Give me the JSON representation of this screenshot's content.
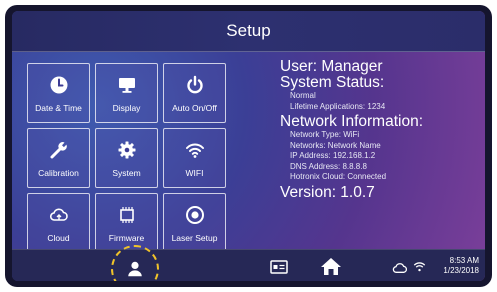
{
  "header": {
    "title": "Setup"
  },
  "tiles": [
    {
      "label": "Date & Time",
      "icon": "clock-icon"
    },
    {
      "label": "Display",
      "icon": "monitor-icon"
    },
    {
      "label": "Auto On/Off",
      "icon": "power-icon"
    },
    {
      "label": "Calibration",
      "icon": "wrench-icon"
    },
    {
      "label": "System",
      "icon": "gear-icon"
    },
    {
      "label": "WIFI",
      "icon": "wifi-icon"
    },
    {
      "label": "Cloud",
      "icon": "cloud-icon"
    },
    {
      "label": "Firmware",
      "icon": "chip-icon"
    },
    {
      "label": "Laser Setup",
      "icon": "target-icon"
    }
  ],
  "info": {
    "user": "User: Manager",
    "system_status_heading": "System Status:",
    "status": "Normal",
    "lifetime_applications": "Lifetime Applications: 1234",
    "network_heading": "Network Information:",
    "network_type": "Network Type: WiFi",
    "networks": "Networks: Network Name",
    "ip_address": "IP Address: 192.168.1.2",
    "dns_address": "DNS Address: 8.8.8.8",
    "hotronix_cloud": "Hotronix Cloud: Connected",
    "version": "Version: 1.0.7"
  },
  "status_bar": {
    "time": "8:53 AM",
    "date": "1/23/2018",
    "icons": [
      "user-icon",
      "card-icon",
      "home-icon",
      "cloud-status-icon",
      "wifi-status-icon"
    ]
  },
  "colors": {
    "highlight_ring": "#f0c32a",
    "bar": "#262856"
  }
}
